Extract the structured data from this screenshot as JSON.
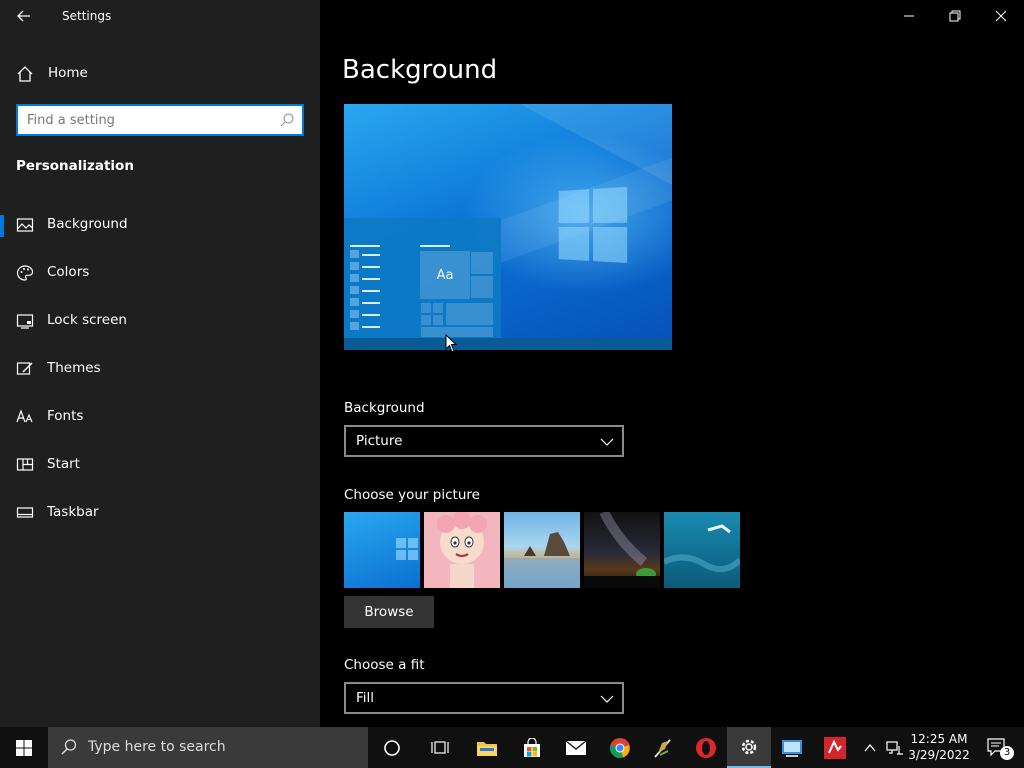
{
  "window": {
    "title": "Settings"
  },
  "sidebar": {
    "home_label": "Home",
    "search_placeholder": "Find a setting",
    "section_title": "Personalization",
    "items": [
      {
        "label": "Background",
        "icon": "picture-icon",
        "active": true
      },
      {
        "label": "Colors",
        "icon": "palette-icon"
      },
      {
        "label": "Lock screen",
        "icon": "lock-screen-icon"
      },
      {
        "label": "Themes",
        "icon": "themes-brush-icon"
      },
      {
        "label": "Fonts",
        "icon": "fonts-icon"
      },
      {
        "label": "Start",
        "icon": "start-grid-icon"
      },
      {
        "label": "Taskbar",
        "icon": "taskbar-icon"
      }
    ]
  },
  "main": {
    "page_title": "Background",
    "preview": {
      "tile_text": "Aa"
    },
    "background_label": "Background",
    "background_value": "Picture",
    "choose_picture_label": "Choose your picture",
    "browse_label": "Browse",
    "fit_label": "Choose a fit",
    "fit_value": "Fill"
  },
  "taskbar": {
    "search_placeholder": "Type here to search",
    "time": "12:25 AM",
    "date": "3/29/2022",
    "notification_count": "3"
  },
  "colors": {
    "accent": "#0078d7",
    "sidebar_bg": "#1f1f1f",
    "main_bg": "#000000"
  }
}
